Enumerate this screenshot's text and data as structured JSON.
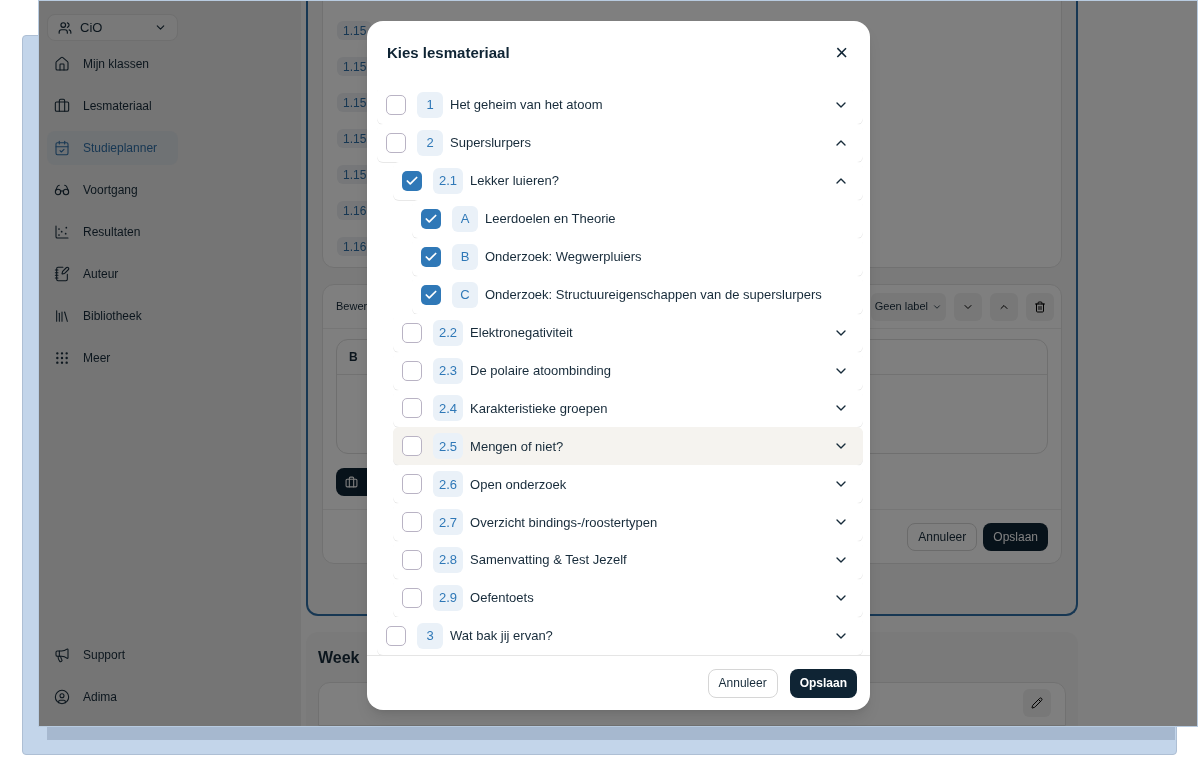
{
  "sidebar": {
    "account": {
      "label": "CiO"
    },
    "items": [
      {
        "label": "Mijn klassen",
        "selected": false
      },
      {
        "label": "Lesmateriaal",
        "selected": false
      },
      {
        "label": "Studieplanner",
        "selected": true
      },
      {
        "label": "Voortgang",
        "selected": false
      },
      {
        "label": "Resultaten",
        "selected": false
      },
      {
        "label": "Auteur",
        "selected": false
      },
      {
        "label": "Bibliotheek",
        "selected": false
      },
      {
        "label": "Meer",
        "selected": false
      }
    ],
    "footer_items": [
      {
        "label": "Support"
      },
      {
        "label": "Adima"
      }
    ]
  },
  "background": {
    "lesson_badges": [
      "1.15",
      "1.15",
      "1.15",
      "1.15",
      "1.15",
      "1.16",
      "1.16"
    ],
    "editor": {
      "title": "Bewer",
      "label_dropdown": "Geen label",
      "toolbar_bold": "B",
      "buttons": [
        "Annuleer",
        "Opslaan"
      ]
    },
    "week_title": "Week"
  },
  "dialog": {
    "title": "Kies lesmateriaal",
    "close": "×",
    "items": [
      {
        "number": "1",
        "title": "Het geheim van het atoom",
        "checked": false,
        "expanded": false,
        "highlighted": false
      },
      {
        "number": "2",
        "title": "Superslurpers",
        "checked": false,
        "expanded": true,
        "highlighted": false,
        "children": [
          {
            "number": "2.1",
            "title": "Lekker luieren?",
            "checked": true,
            "expanded": true,
            "highlighted": false,
            "children": [
              {
                "number": "A",
                "title": "Leerdoelen en Theorie",
                "checked": true,
                "highlighted": false
              },
              {
                "number": "B",
                "title": "Onderzoek: Wegwerpluiers",
                "checked": true,
                "highlighted": false
              },
              {
                "number": "C",
                "title": "Onderzoek: Structuureigenschappen van de superslurpers",
                "checked": true,
                "highlighted": false
              }
            ]
          },
          {
            "number": "2.2",
            "title": "Elektronegativiteit",
            "checked": false,
            "expanded": false,
            "highlighted": false
          },
          {
            "number": "2.3",
            "title": "De polaire atoombinding",
            "checked": false,
            "expanded": false,
            "highlighted": false
          },
          {
            "number": "2.4",
            "title": "Karakteristieke groepen",
            "checked": false,
            "expanded": false,
            "highlighted": false
          },
          {
            "number": "2.5",
            "title": "Mengen of niet?",
            "checked": false,
            "expanded": false,
            "highlighted": true
          },
          {
            "number": "2.6",
            "title": "Open onderzoek",
            "checked": false,
            "expanded": false,
            "highlighted": false
          },
          {
            "number": "2.7",
            "title": "Overzicht bindings-/roostertypen",
            "checked": false,
            "expanded": false,
            "highlighted": false
          },
          {
            "number": "2.8",
            "title": "Samenvatting & Test Jezelf",
            "checked": false,
            "expanded": false,
            "highlighted": false
          },
          {
            "number": "2.9",
            "title": "Oefentoets",
            "checked": false,
            "expanded": false,
            "highlighted": false
          }
        ]
      },
      {
        "number": "3",
        "title": "Wat bak jij ervan?",
        "checked": false,
        "expanded": false,
        "highlighted": false
      }
    ],
    "buttons": [
      {
        "label": "Annuleer",
        "kind": "secondary"
      },
      {
        "label": "Opslaan",
        "kind": "primary"
      }
    ]
  }
}
